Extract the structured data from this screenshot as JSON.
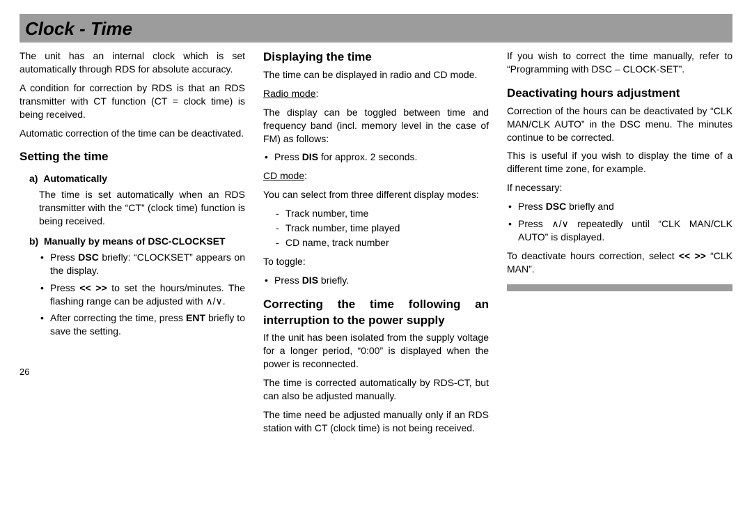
{
  "title": "Clock - Time",
  "page_number": "26",
  "col1": {
    "p1": "The unit has an internal clock which is set automatically through RDS for absolute accuracy.",
    "p2": "A condition for correction by RDS is that an RDS transmitter with CT function (CT = clock time) is being received.",
    "p3": "Automatic correction of the time can be deactivated.",
    "h_setting": "Setting the time",
    "a_label": "a)  Automatically",
    "a_desc": "The time is set automatically when an RDS transmitter with the “CT” (clock time) function is being received.",
    "b_label": "b)  Manually by means of DSC-CLOCKSET",
    "b_bullets": {
      "i1_pre": "Press ",
      "i1_bold": "DSC",
      "i1_post": " briefly: “CLOCKSET” appears on the display.",
      "i2_pre": "Press ",
      "i2_bold": "<< >>",
      "i2_mid": " to set the hours/minutes. The flashing range can be adjusted with ",
      "i2_up": "∧",
      "i2_slash": "/",
      "i2_down": "∨",
      "i2_end": ".",
      "i3_pre": "After correcting the time, press ",
      "i3_bold": "ENT",
      "i3_post": " briefly to save the setting."
    }
  },
  "col2": {
    "h_display": "Displaying the time",
    "p1": "The time can be displayed in radio and CD mode.",
    "radio_label": "Radio mode",
    "radio_colon": ":",
    "p2": "The display can be toggled between time and frequency band (incl. memory level in the case of FM) as follows:",
    "radio_bullet_pre": "Press ",
    "radio_bullet_bold": "DIS",
    "radio_bullet_post": " for approx. 2 seconds.",
    "cd_label": "CD mode",
    "cd_colon": ":",
    "p3": "You can select from three different display modes:",
    "dashes": {
      "d1": "Track number, time",
      "d2": "Track number, time played",
      "d3": "CD name, track number"
    },
    "toggle_label": "To toggle:",
    "toggle_bullet_pre": "Press ",
    "toggle_bullet_bold": "DIS",
    "toggle_bullet_post": " briefly.",
    "h_correcting": "Correcting the time following an interruption to the power supply",
    "p4": "If the unit has been isolated from the supply voltage for a longer period, “0:00” is displayed when the power is reconnected.",
    "p5": "The time is corrected automatically by RDS-CT, but can also be adjusted manually.",
    "p6": "The time need be adjusted manually only if an RDS station with CT (clock time) is not being received."
  },
  "col3": {
    "p1": "If you wish to correct the time manually, refer to “Programming with DSC – CLOCK-SET”.",
    "h_deact": "Deactivating hours adjustment",
    "p2": "Correction of the hours can be deactivated by “CLK MAN/CLK AUTO” in the DSC menu. The minutes continue to be corrected.",
    "p3": "This is useful if you wish to display the time of a different time zone, for example.",
    "p4": "If necessary:",
    "b1_pre": "Press ",
    "b1_bold": "DSC",
    "b1_post": " briefly and",
    "b2_pre": "Press ",
    "b2_up": "∧",
    "b2_slash": "/",
    "b2_down": "∨",
    "b2_post": " repeatedly until “CLK MAN/CLK AUTO” is displayed.",
    "p5_pre": "To deactivate hours correction, select ",
    "p5_bold": "<< >>",
    "p5_post": " “CLK MAN”."
  }
}
